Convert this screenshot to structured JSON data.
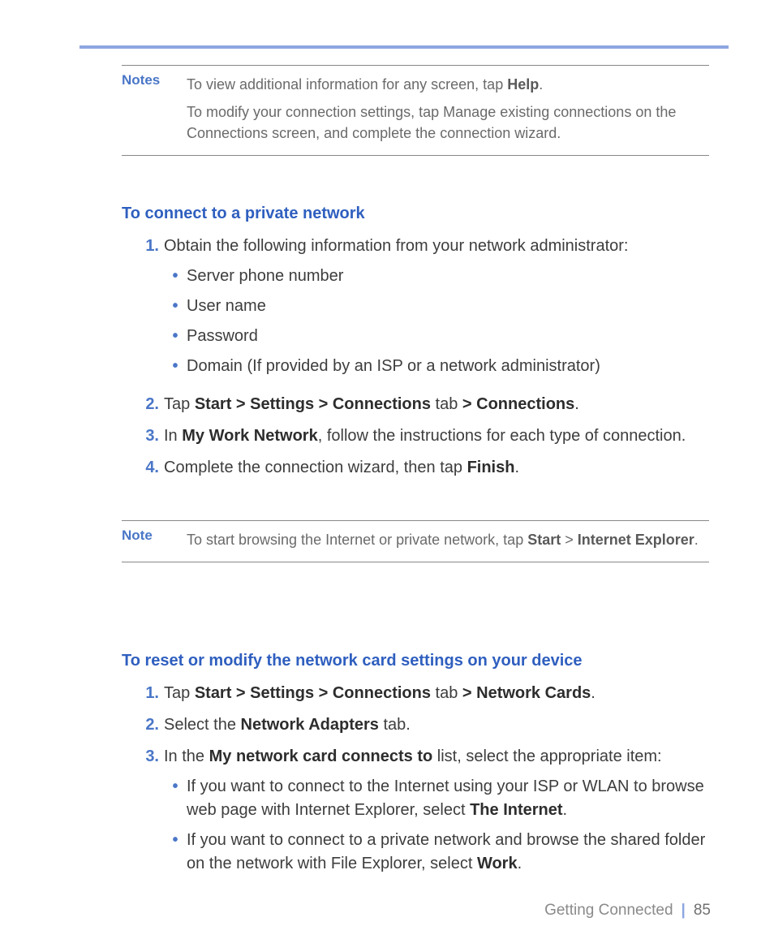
{
  "notes1": {
    "label": "Notes",
    "line1_pre": "To view additional information for any screen, tap ",
    "line1_bold": "Help",
    "line1_post": ".",
    "line2": "To modify your connection settings, tap Manage existing connections on the Connections screen, and complete the connection wizard."
  },
  "section1": {
    "heading": "To connect to a private network",
    "step1": {
      "num": "1.",
      "text": "Obtain the following information from your network administrator:",
      "bullets": [
        "Server phone number",
        "User name",
        "Password",
        "Domain (If provided by an ISP or a network administrator)"
      ]
    },
    "step2": {
      "num": "2.",
      "pre": "Tap ",
      "b1": "Start > Settings > Connections",
      "mid": " tab ",
      "b2": "> Connections",
      "post": "."
    },
    "step3": {
      "num": "3.",
      "pre": "In ",
      "b1": "My Work Network",
      "post": ", follow the instructions for each type of connection."
    },
    "step4": {
      "num": "4.",
      "pre": "Complete the connection wizard, then tap ",
      "b1": "Finish",
      "post": "."
    }
  },
  "note2": {
    "label": "Note",
    "pre": "To start browsing the Internet or private network, tap ",
    "b1": "Start",
    "mid": " > ",
    "b2": "Internet Explorer",
    "post": "."
  },
  "section2": {
    "heading": "To reset or modify the network card settings on your device",
    "step1": {
      "num": "1.",
      "pre": "Tap ",
      "b1": "Start > Settings > Connections",
      "mid": " tab ",
      "b2": "> Network Cards",
      "post": "."
    },
    "step2": {
      "num": "2.",
      "pre": "Select the ",
      "b1": "Network Adapters",
      "post": " tab."
    },
    "step3": {
      "num": "3.",
      "pre": "In the ",
      "b1": "My network card connects to",
      "post": " list, select the appropriate item:",
      "bullet1": {
        "pre": "If you want to connect to the Internet using your ISP or WLAN to browse web page with Internet Explorer, select ",
        "b1": "The Internet",
        "post": "."
      },
      "bullet2": {
        "pre": "If you want to connect to a private network and browse the shared folder on the network with File Explorer, select ",
        "b1": "Work",
        "post": "."
      }
    }
  },
  "footer": {
    "title": "Getting Connected",
    "page": "85"
  }
}
